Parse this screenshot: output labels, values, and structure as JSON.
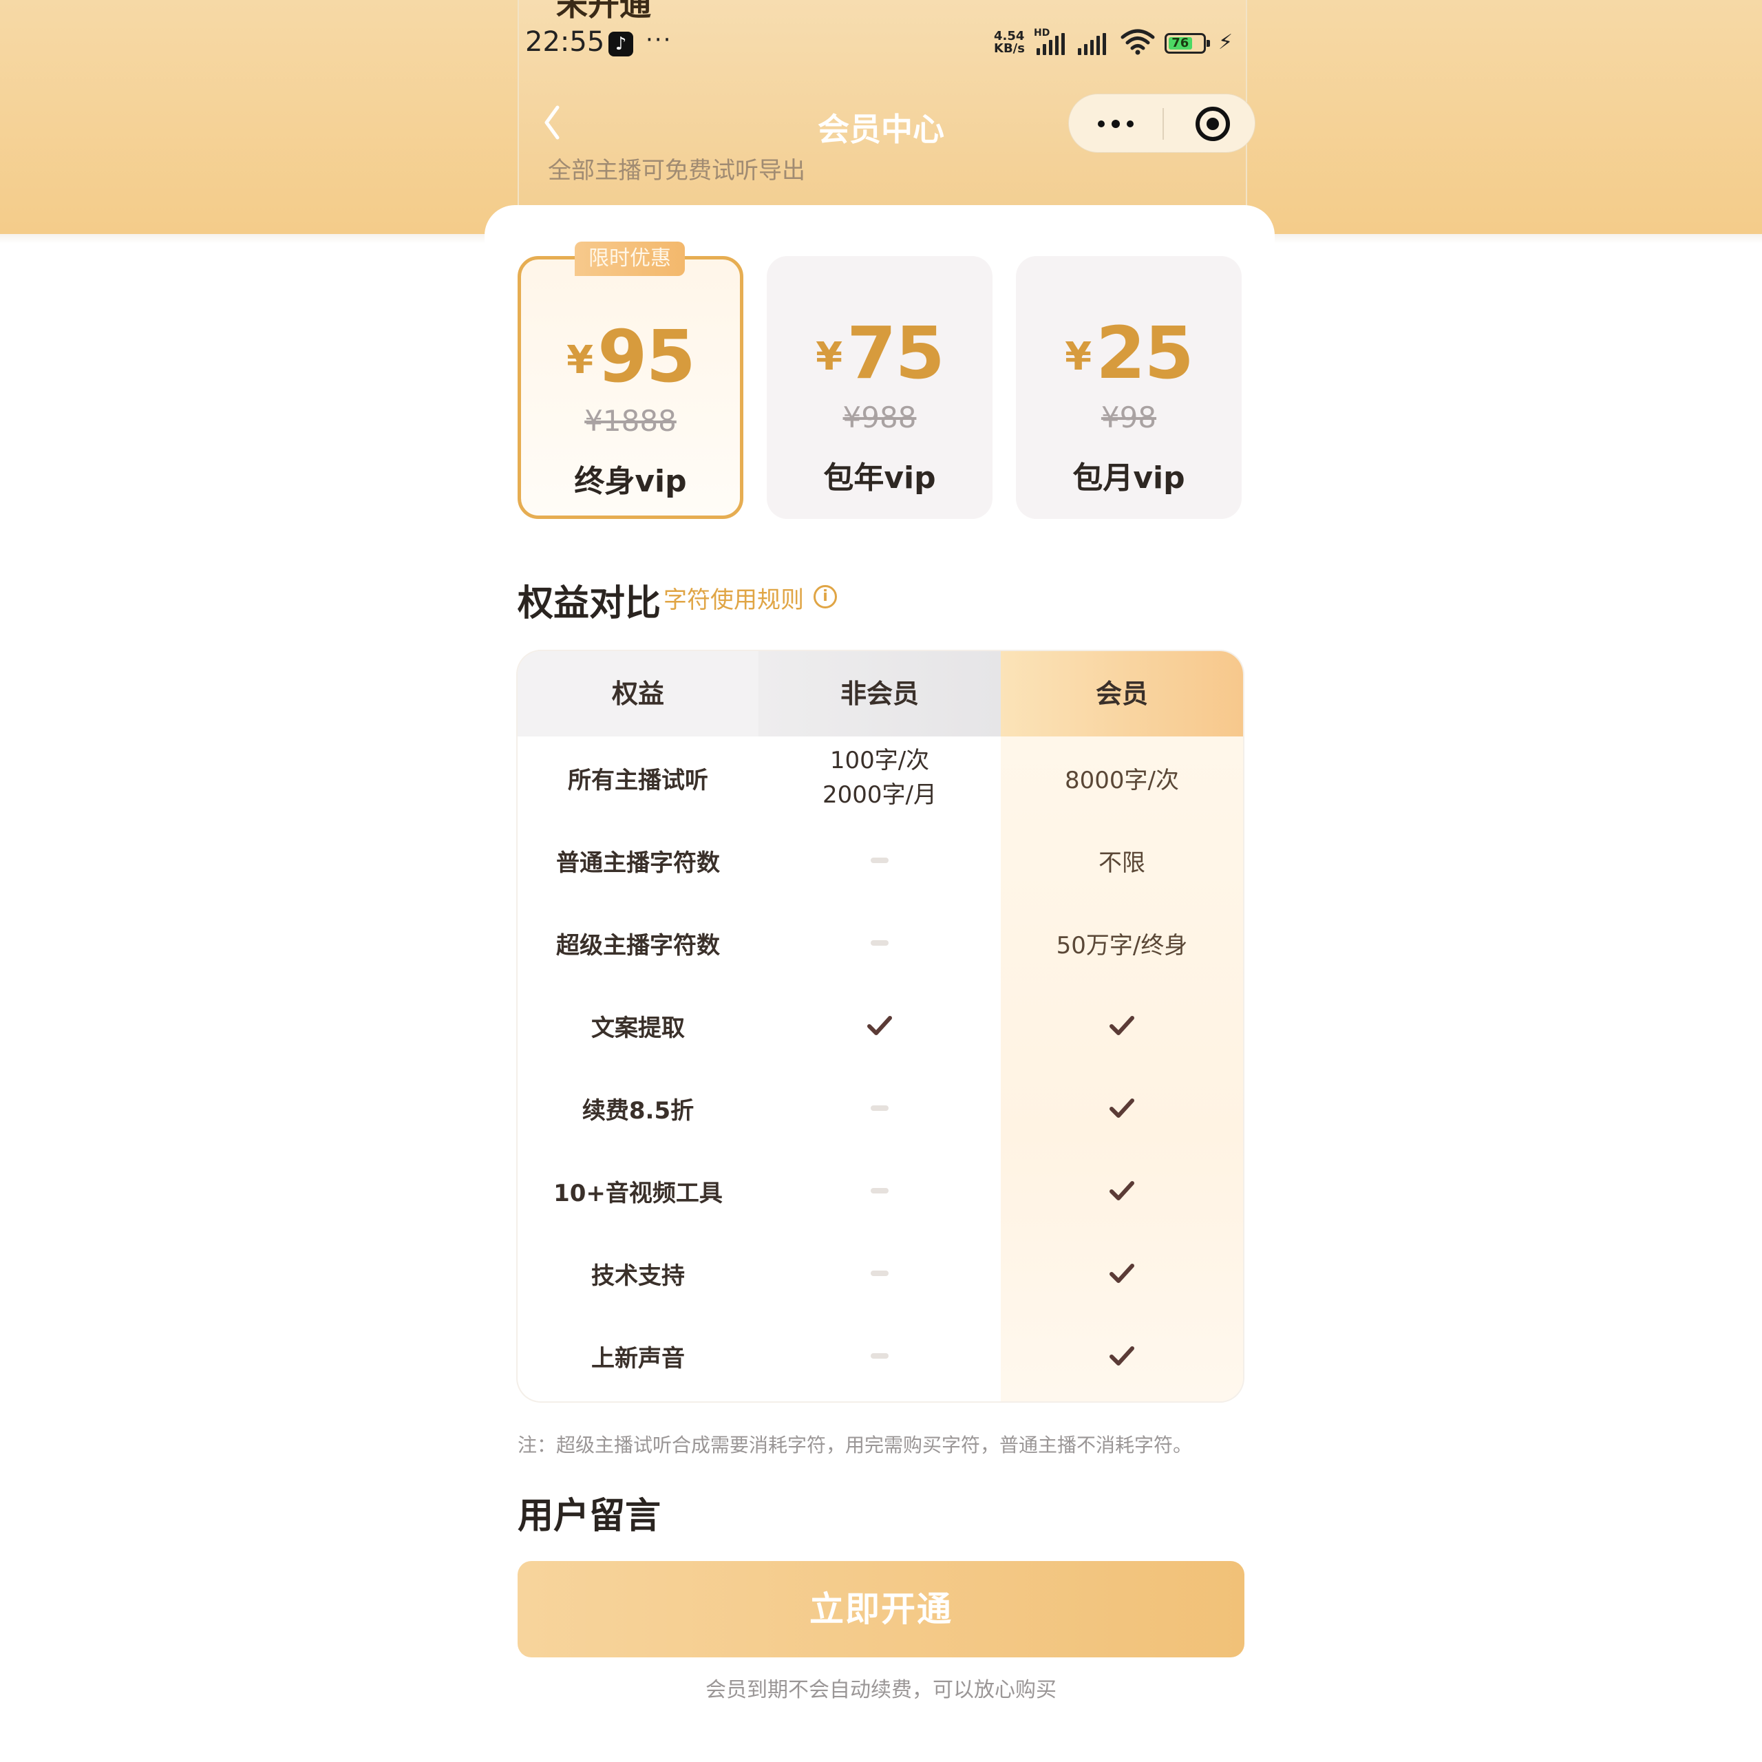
{
  "top_headline": "未开通",
  "status_bar": {
    "time": "22:55",
    "more": "···",
    "net_speed_value": "4.54",
    "net_speed_unit": "KB/s",
    "hd": "HD",
    "battery": "76"
  },
  "nav": {
    "title": "会员中心",
    "subtitle": "全部主播可免费试听导出"
  },
  "plans": [
    {
      "badge": "限时优惠",
      "currency": "¥",
      "price": "95",
      "original": "¥1888",
      "name": "终身vip",
      "selected": true
    },
    {
      "currency": "¥",
      "price": "75",
      "original": "¥988",
      "name": "包年vip",
      "selected": false
    },
    {
      "currency": "¥",
      "price": "25",
      "original": "¥98",
      "name": "包月vip",
      "selected": false
    }
  ],
  "benefits_section": {
    "title": "权益对比",
    "rules_link": "字符使用规则"
  },
  "table": {
    "headers": [
      "权益",
      "非会员",
      "会员"
    ],
    "rows": [
      {
        "feature": "所有主播试听",
        "non_member": [
          "100字/次",
          "2000字/月"
        ],
        "member": "8000字/次"
      },
      {
        "feature": "普通主播字符数",
        "non_member": "dash",
        "member": "不限"
      },
      {
        "feature": "超级主播字符数",
        "non_member": "dash",
        "member": "50万字/终身"
      },
      {
        "feature": "文案提取",
        "non_member": "check",
        "member": "check"
      },
      {
        "feature": "续费8.5折",
        "non_member": "dash",
        "member": "check"
      },
      {
        "feature": "10+音视频工具",
        "non_member": "dash",
        "member": "check"
      },
      {
        "feature": "技术支持",
        "non_member": "dash",
        "member": "check"
      },
      {
        "feature": "上新声音",
        "non_member": "dash",
        "member": "check"
      }
    ]
  },
  "note": "注：超级主播试听合成需要消耗字符，用完需购买字符，普通主播不消耗字符。",
  "comments_section": {
    "title": "用户留言"
  },
  "cta": {
    "label": "立即开通",
    "footnote": "会员到期不会自动续费，可以放心购买"
  },
  "colors": {
    "accent_gold": "#d79b3d",
    "selected_border": "#e6ad52",
    "check": "#5b3b36",
    "cta_gradient_start": "#f7d49c",
    "cta_gradient_end": "#f1c178"
  }
}
